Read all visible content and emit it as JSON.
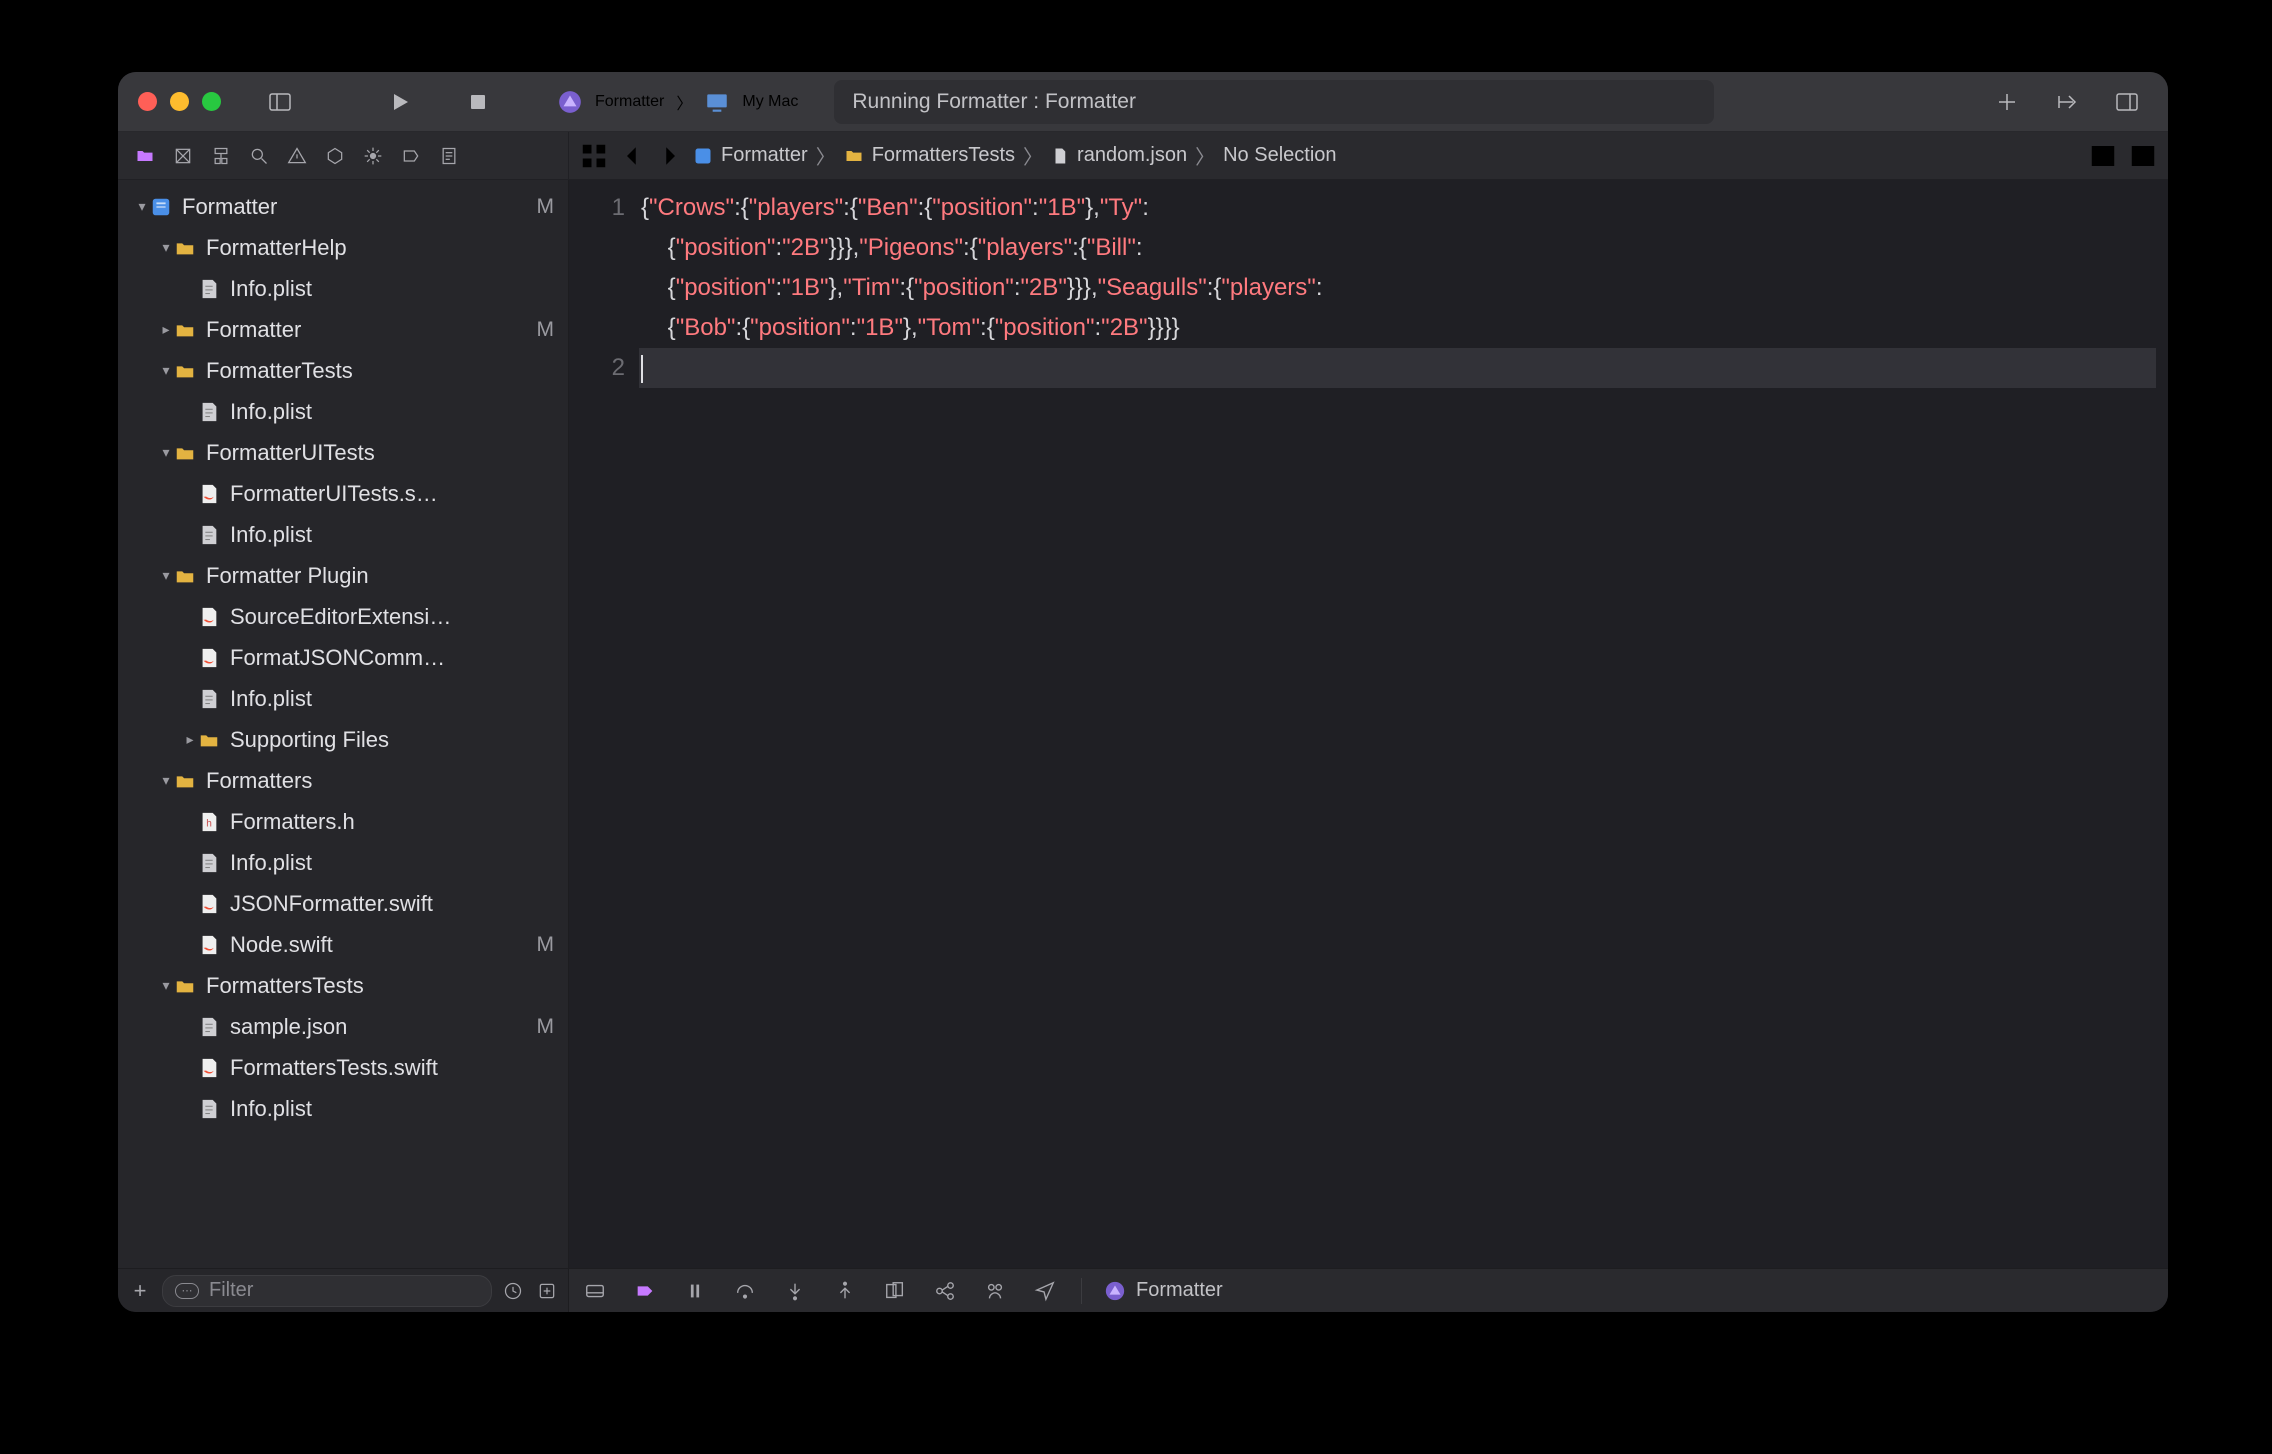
{
  "toolbar": {
    "scheme_name": "Formatter",
    "scheme_destination": "My Mac",
    "activity": "Running Formatter : Formatter"
  },
  "breadcrumbs": {
    "project": "Formatter",
    "folder1": "FormattersTests",
    "file": "random.json",
    "selection": "No Selection"
  },
  "tree": [
    {
      "depth": 0,
      "kind": "project",
      "label": "Formatter",
      "badge": "M",
      "expanded": true
    },
    {
      "depth": 1,
      "kind": "folder",
      "label": "FormatterHelp",
      "expanded": true
    },
    {
      "depth": 2,
      "kind": "plist",
      "label": "Info.plist"
    },
    {
      "depth": 1,
      "kind": "folder",
      "label": "Formatter",
      "badge": "M",
      "collapsed": true
    },
    {
      "depth": 1,
      "kind": "folder",
      "label": "FormatterTests",
      "expanded": true
    },
    {
      "depth": 2,
      "kind": "plist",
      "label": "Info.plist"
    },
    {
      "depth": 1,
      "kind": "folder",
      "label": "FormatterUITests",
      "expanded": true
    },
    {
      "depth": 2,
      "kind": "swift",
      "label": "FormatterUITests.s…"
    },
    {
      "depth": 2,
      "kind": "plist",
      "label": "Info.plist"
    },
    {
      "depth": 1,
      "kind": "folder",
      "label": "Formatter Plugin",
      "expanded": true
    },
    {
      "depth": 2,
      "kind": "swift",
      "label": "SourceEditorExtensi…"
    },
    {
      "depth": 2,
      "kind": "swift",
      "label": "FormatJSONComm…"
    },
    {
      "depth": 2,
      "kind": "plist",
      "label": "Info.plist"
    },
    {
      "depth": 2,
      "kind": "folder",
      "label": "Supporting Files",
      "collapsed": true
    },
    {
      "depth": 1,
      "kind": "folder",
      "label": "Formatters",
      "expanded": true
    },
    {
      "depth": 2,
      "kind": "header",
      "label": "Formatters.h"
    },
    {
      "depth": 2,
      "kind": "plist",
      "label": "Info.plist"
    },
    {
      "depth": 2,
      "kind": "swift",
      "label": "JSONFormatter.swift"
    },
    {
      "depth": 2,
      "kind": "swift",
      "label": "Node.swift",
      "badge": "M"
    },
    {
      "depth": 1,
      "kind": "folder",
      "label": "FormattersTests",
      "expanded": true
    },
    {
      "depth": 2,
      "kind": "json",
      "label": "sample.json",
      "badge": "M"
    },
    {
      "depth": 2,
      "kind": "swift",
      "label": "FormattersTests.swift"
    },
    {
      "depth": 2,
      "kind": "plist",
      "label": "Info.plist"
    }
  ],
  "filter": {
    "placeholder": "Filter"
  },
  "editor": {
    "line_numbers": [
      "1",
      "2"
    ],
    "tokens": [
      [
        {
          "t": "p",
          "v": "{"
        },
        {
          "t": "s",
          "v": "\"Crows\""
        },
        {
          "t": "p",
          "v": ":{"
        },
        {
          "t": "s",
          "v": "\"players\""
        },
        {
          "t": "p",
          "v": ":{"
        },
        {
          "t": "s",
          "v": "\"Ben\""
        },
        {
          "t": "p",
          "v": ":{"
        },
        {
          "t": "s",
          "v": "\"position\""
        },
        {
          "t": "p",
          "v": ":"
        },
        {
          "t": "s",
          "v": "\"1B\""
        },
        {
          "t": "p",
          "v": "},"
        },
        {
          "t": "s",
          "v": "\"Ty\""
        },
        {
          "t": "p",
          "v": ":"
        }
      ],
      [
        {
          "t": "p",
          "v": "    {"
        },
        {
          "t": "s",
          "v": "\"position\""
        },
        {
          "t": "p",
          "v": ":"
        },
        {
          "t": "s",
          "v": "\"2B\""
        },
        {
          "t": "p",
          "v": "}}},"
        },
        {
          "t": "s",
          "v": "\"Pigeons\""
        },
        {
          "t": "p",
          "v": ":{"
        },
        {
          "t": "s",
          "v": "\"players\""
        },
        {
          "t": "p",
          "v": ":{"
        },
        {
          "t": "s",
          "v": "\"Bill\""
        },
        {
          "t": "p",
          "v": ":"
        }
      ],
      [
        {
          "t": "p",
          "v": "    {"
        },
        {
          "t": "s",
          "v": "\"position\""
        },
        {
          "t": "p",
          "v": ":"
        },
        {
          "t": "s",
          "v": "\"1B\""
        },
        {
          "t": "p",
          "v": "},"
        },
        {
          "t": "s",
          "v": "\"Tim\""
        },
        {
          "t": "p",
          "v": ":{"
        },
        {
          "t": "s",
          "v": "\"position\""
        },
        {
          "t": "p",
          "v": ":"
        },
        {
          "t": "s",
          "v": "\"2B\""
        },
        {
          "t": "p",
          "v": "}}},"
        },
        {
          "t": "s",
          "v": "\"Seagulls\""
        },
        {
          "t": "p",
          "v": ":{"
        },
        {
          "t": "s",
          "v": "\"players\""
        },
        {
          "t": "p",
          "v": ":"
        }
      ],
      [
        {
          "t": "p",
          "v": "    {"
        },
        {
          "t": "s",
          "v": "\"Bob\""
        },
        {
          "t": "p",
          "v": ":{"
        },
        {
          "t": "s",
          "v": "\"position\""
        },
        {
          "t": "p",
          "v": ":"
        },
        {
          "t": "s",
          "v": "\"1B\""
        },
        {
          "t": "p",
          "v": "},"
        },
        {
          "t": "s",
          "v": "\"Tom\""
        },
        {
          "t": "p",
          "v": ":{"
        },
        {
          "t": "s",
          "v": "\"position\""
        },
        {
          "t": "p",
          "v": ":"
        },
        {
          "t": "s",
          "v": "\"2B\""
        },
        {
          "t": "p",
          "v": "}}}}"
        }
      ]
    ]
  },
  "debugbar": {
    "process": "Formatter"
  }
}
